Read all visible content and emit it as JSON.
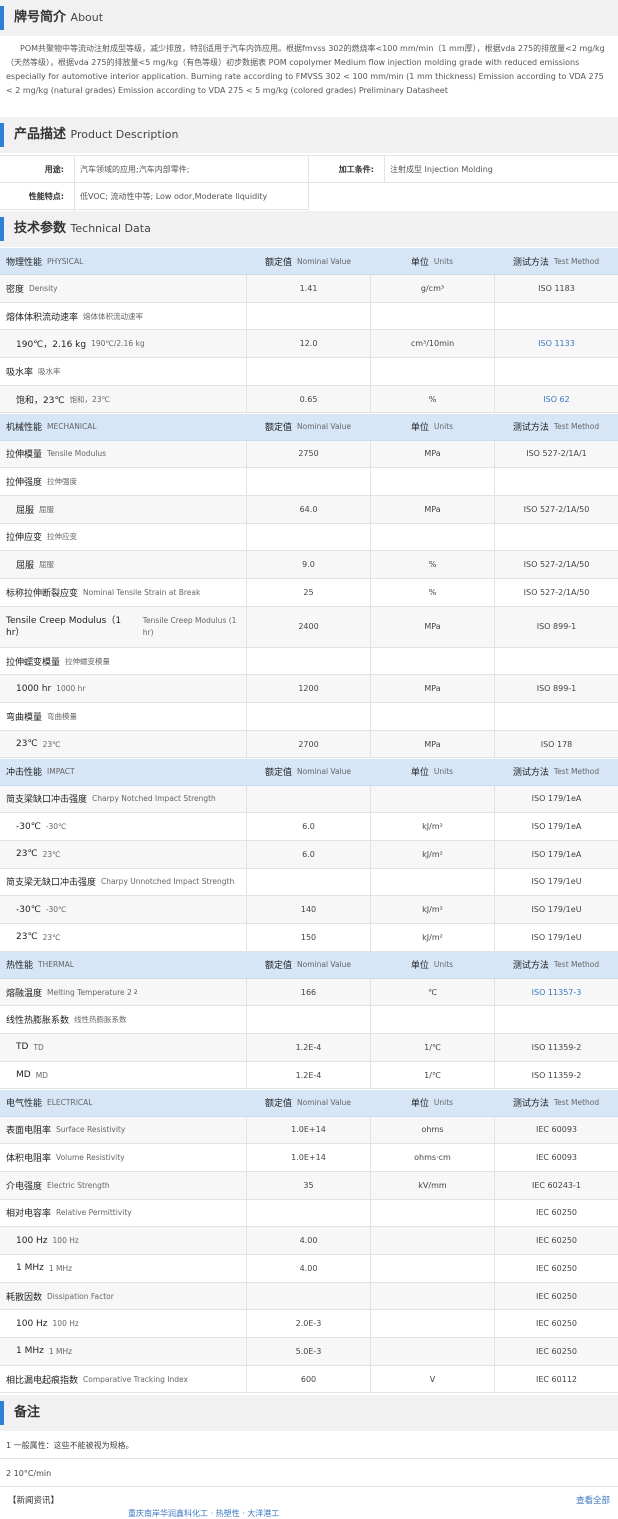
{
  "about": {
    "title_zh": "牌号简介",
    "title_en": "About",
    "text": "POM共聚物中等流动注射成型等级，减少排放，特别适用于汽车内饰应用。根据fmvss 302的燃烧率<100 mm/min（1 mm厚），根据vda 275的排放量<2 mg/kg（天然等级），根据vda 275的排放量<5 mg/kg（有色等级）初步数据表   POM copolymer Medium flow injection molding grade with reduced emissions especially for automotive interior application. Burning rate according to FMVSS 302 < 100 mm/min (1 mm thickness) Emission according to VDA 275 < 2 mg/kg (natural grades) Emission according to VDA 275 < 5 mg/kg (colored grades) Preliminary Datasheet"
  },
  "product": {
    "title_zh": "产品描述",
    "title_en": "Product Description",
    "use_key": "用途:",
    "use_val": "汽车领域的应用;汽车内部零件;",
    "process_key": "加工条件:",
    "process_val": "注射成型  Injection Molding",
    "feature_key": "性能特点:",
    "feature_val": "低VOC; 流动性中等;  Low odor,Moderate liquidity"
  },
  "tech": {
    "title_zh": "技术参数",
    "title_en": "Technical Data",
    "rows": [
      {
        "t": "g",
        "zh": "物理性能",
        "en": "PHYSICAL",
        "v": "额定值  Nominal Value",
        "u": "单位  Units",
        "m": "测试方法  Test Method"
      },
      {
        "t": "d",
        "zh": "密度",
        "en": "Density",
        "v": "1.41",
        "u": "g/cm³",
        "m": "ISO 1183"
      },
      {
        "t": "d",
        "zh": "熔体体积流动速率",
        "en": "熔体体积流动速率",
        "v": "",
        "u": "",
        "m": ""
      },
      {
        "t": "s",
        "zh": "190℃，2.16 kg",
        "en": "190℃/2.16 kg",
        "v": "12.0",
        "u": "cm³/10min",
        "m": "ISO 1133",
        "link": true
      },
      {
        "t": "d",
        "zh": "吸水率",
        "en": "吸水率",
        "v": "",
        "u": "",
        "m": ""
      },
      {
        "t": "s",
        "zh": "饱和，23℃",
        "en": "饱和，23℃",
        "v": "0.65",
        "u": "%",
        "m": "ISO 62",
        "link": true
      },
      {
        "t": "g",
        "zh": "机械性能",
        "en": "MECHANICAL",
        "v": "额定值  Nominal Value",
        "u": "单位  Units",
        "m": "测试方法  Test Method"
      },
      {
        "t": "d",
        "zh": "拉伸模量",
        "en": "Tensile Modulus",
        "v": "2750",
        "u": "MPa",
        "m": "ISO 527-2/1A/1"
      },
      {
        "t": "d",
        "zh": "拉伸强度",
        "en": "拉伸强度",
        "v": "",
        "u": "",
        "m": ""
      },
      {
        "t": "s",
        "zh": "屈服",
        "en": "屈服",
        "v": "64.0",
        "u": "MPa",
        "m": "ISO 527-2/1A/50"
      },
      {
        "t": "d",
        "zh": "拉伸应变",
        "en": "拉伸应变",
        "v": "",
        "u": "",
        "m": ""
      },
      {
        "t": "s",
        "zh": "屈服",
        "en": "屈服",
        "v": "9.0",
        "u": "%",
        "m": "ISO 527-2/1A/50"
      },
      {
        "t": "d",
        "zh": "标称拉伸断裂应变",
        "en": "Nominal Tensile Strain at Break",
        "v": "25",
        "u": "%",
        "m": "ISO 527-2/1A/50"
      },
      {
        "t": "d",
        "zh": "Tensile Creep Modulus（1 hr）",
        "en": "Tensile Creep Modulus (1 hr)",
        "v": "2400",
        "u": "MPa",
        "m": "ISO 899-1",
        "tall": true
      },
      {
        "t": "d",
        "zh": "拉伸蠕变模量",
        "en": "拉伸蠕变模量",
        "v": "",
        "u": "",
        "m": ""
      },
      {
        "t": "s",
        "zh": "1000 hr",
        "en": "1000 hr",
        "v": "1200",
        "u": "MPa",
        "m": "ISO 899-1"
      },
      {
        "t": "d",
        "zh": "弯曲模量",
        "en": "弯曲模量",
        "v": "",
        "u": "",
        "m": ""
      },
      {
        "t": "s",
        "zh": "23℃",
        "en": "23℃",
        "v": "2700",
        "u": "MPa",
        "m": "ISO 178"
      },
      {
        "t": "g",
        "zh": "冲击性能",
        "en": "IMPACT",
        "v": "额定值  Nominal Value",
        "u": "单位  Units",
        "m": "测试方法  Test Method"
      },
      {
        "t": "d",
        "zh": "简支梁缺口冲击强度",
        "en": "Charpy Notched Impact Strength",
        "v": "",
        "u": "",
        "m": "ISO 179/1eA"
      },
      {
        "t": "s",
        "zh": "-30℃",
        "en": "-30℃",
        "v": "6.0",
        "u": "kJ/m²",
        "m": "ISO 179/1eA"
      },
      {
        "t": "s",
        "zh": "23℃",
        "en": "23℃",
        "v": "6.0",
        "u": "kJ/m²",
        "m": "ISO 179/1eA"
      },
      {
        "t": "d",
        "zh": "简支梁无缺口冲击强度",
        "en": "Charpy Unnotched Impact Strength",
        "v": "",
        "u": "",
        "m": "ISO 179/1eU"
      },
      {
        "t": "s",
        "zh": "-30℃",
        "en": "-30℃",
        "v": "140",
        "u": "kJ/m²",
        "m": "ISO 179/1eU"
      },
      {
        "t": "s",
        "zh": "23℃",
        "en": "23℃",
        "v": "150",
        "u": "kJ/m²",
        "m": "ISO 179/1eU"
      },
      {
        "t": "g",
        "zh": "热性能",
        "en": "THERMAL",
        "v": "额定值  Nominal Value",
        "u": "单位  Units",
        "m": "测试方法  Test Method"
      },
      {
        "t": "d",
        "zh": "熔融温度",
        "en": "Melting Temperature  2",
        "sup": "2",
        "v": "166",
        "u": "℃",
        "m": "ISO 11357-3",
        "link": true
      },
      {
        "t": "d",
        "zh": "线性热膨胀系数",
        "en": "线性热膨胀系数",
        "v": "",
        "u": "",
        "m": ""
      },
      {
        "t": "s",
        "zh": "TD",
        "en": "TD",
        "v": "1.2E-4",
        "u": "1/℃",
        "m": "ISO 11359-2"
      },
      {
        "t": "s",
        "zh": "MD",
        "en": "MD",
        "v": "1.2E-4",
        "u": "1/℃",
        "m": "ISO 11359-2"
      },
      {
        "t": "g",
        "zh": "电气性能",
        "en": "ELECTRICAL",
        "v": "额定值  Nominal Value",
        "u": "单位  Units",
        "m": "测试方法  Test Method"
      },
      {
        "t": "d",
        "zh": "表面电阻率",
        "en": "Surface Resistivity",
        "v": "1.0E+14",
        "u": "ohms",
        "m": "IEC 60093"
      },
      {
        "t": "d",
        "zh": "体积电阻率",
        "en": "Volume Resistivity",
        "v": "1.0E+14",
        "u": "ohms·cm",
        "m": "IEC 60093"
      },
      {
        "t": "d",
        "zh": "介电强度",
        "en": "Electric Strength",
        "v": "35",
        "u": "kV/mm",
        "m": "IEC 60243-1"
      },
      {
        "t": "d",
        "zh": "相对电容率",
        "en": "Relative Permittivity",
        "v": "",
        "u": "",
        "m": "IEC 60250"
      },
      {
        "t": "s",
        "zh": "100 Hz",
        "en": "100 Hz",
        "v": "4.00",
        "u": "",
        "m": "IEC 60250"
      },
      {
        "t": "s",
        "zh": "1 MHz",
        "en": "1 MHz",
        "v": "4.00",
        "u": "",
        "m": "IEC 60250"
      },
      {
        "t": "d",
        "zh": "耗散因数",
        "en": "Dissipation Factor",
        "v": "",
        "u": "",
        "m": "IEC 60250"
      },
      {
        "t": "s",
        "zh": "100 Hz",
        "en": "100 Hz",
        "v": "2.0E-3",
        "u": "",
        "m": "IEC 60250"
      },
      {
        "t": "s",
        "zh": "1 MHz",
        "en": "1 MHz",
        "v": "5.0E-3",
        "u": "",
        "m": "IEC 60250"
      },
      {
        "t": "d",
        "zh": "相比漏电起痕指数",
        "en": "Comparative Tracking Index",
        "v": "600",
        "u": "V",
        "m": "IEC 60112"
      }
    ]
  },
  "notes": {
    "title_zh": "备注",
    "lines": [
      "1 一般属性：这些不能被视为规格。",
      "2 10°C/min"
    ]
  },
  "news": {
    "label": "【新闻资讯】",
    "more": "查看全部",
    "peek": "重庆南岸华润鑫科化工 · 热塑性 · 大洋港工"
  }
}
